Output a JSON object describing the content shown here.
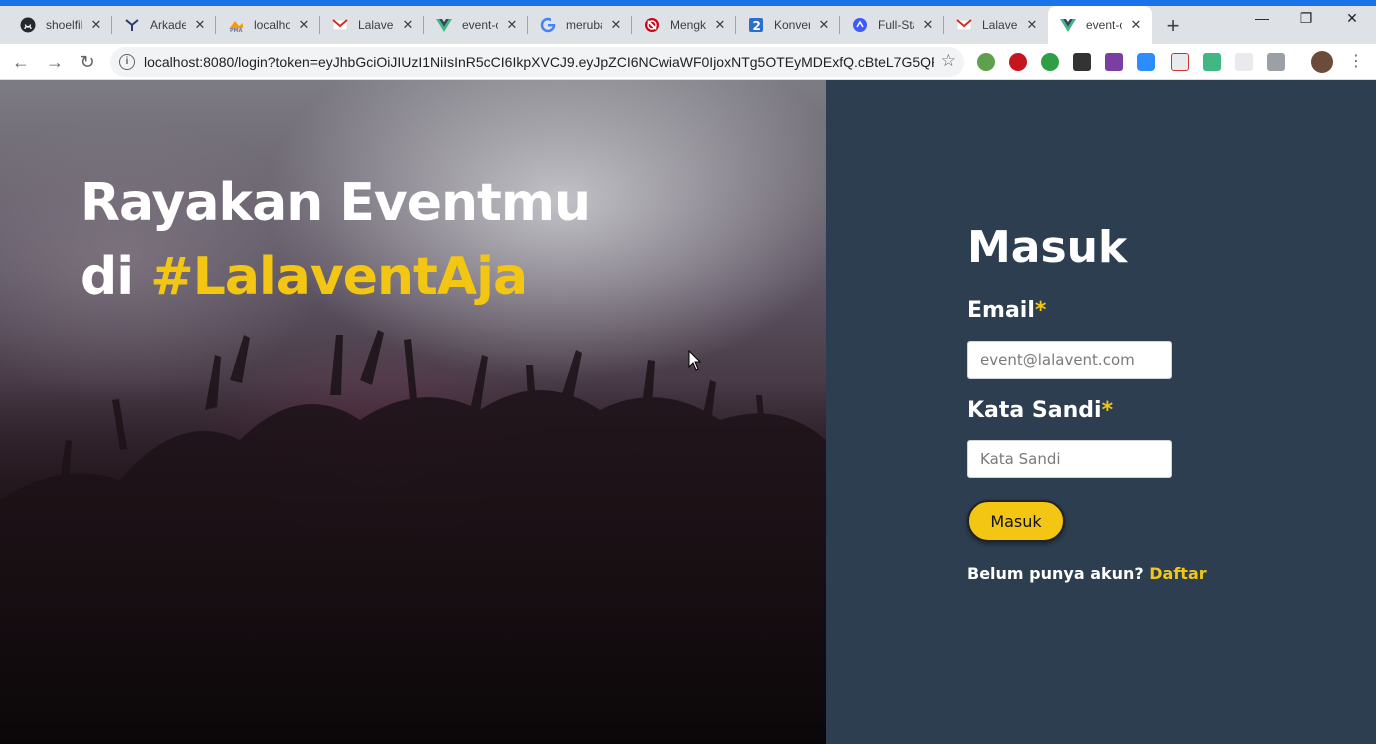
{
  "browser": {
    "tabs": [
      {
        "title": "shoelfil",
        "icon": "github-icon"
      },
      {
        "title": "Arkade",
        "icon": "arkademy-icon"
      },
      {
        "title": "localho",
        "icon": "phpmyadmin-icon"
      },
      {
        "title": "Lalaven",
        "icon": "gmail-icon"
      },
      {
        "title": "event-c",
        "icon": "vue-icon"
      },
      {
        "title": "meruba",
        "icon": "google-icon"
      },
      {
        "title": "Mengk",
        "icon": "opera-icon"
      },
      {
        "title": "Konver",
        "icon": "number-icon"
      },
      {
        "title": "Full-Sta",
        "icon": "blue-circle-icon"
      },
      {
        "title": "Lalaven",
        "icon": "gmail-icon"
      },
      {
        "title": "event-c",
        "icon": "vue-icon"
      }
    ],
    "url": "localhost:8080/login?token=eyJhbGciOiJIUzI1NiIsInR5cCI6IkpXVCJ9.eyJpZCI6NCwiaWF0IjoxNTg5OTEyMDExfQ.cBteL7G5QPZ..."
  },
  "hero": {
    "line1": "Rayakan Eventmu",
    "line2_prefix": "di ",
    "hashtag": "#LalaventAja"
  },
  "login": {
    "title": "Masuk",
    "email_label": "Email",
    "email_placeholder": "event@lalavent.com",
    "password_label": "Kata Sandi",
    "password_placeholder": "Kata Sandi",
    "required_mark": "*",
    "submit_label": "Masuk",
    "signup_prompt": "Belum punya akun? ",
    "signup_link": "Daftar"
  },
  "colors": {
    "accent": "#f3c614",
    "panel": "#2c3e50",
    "chrome_blue": "#1a73e8"
  }
}
